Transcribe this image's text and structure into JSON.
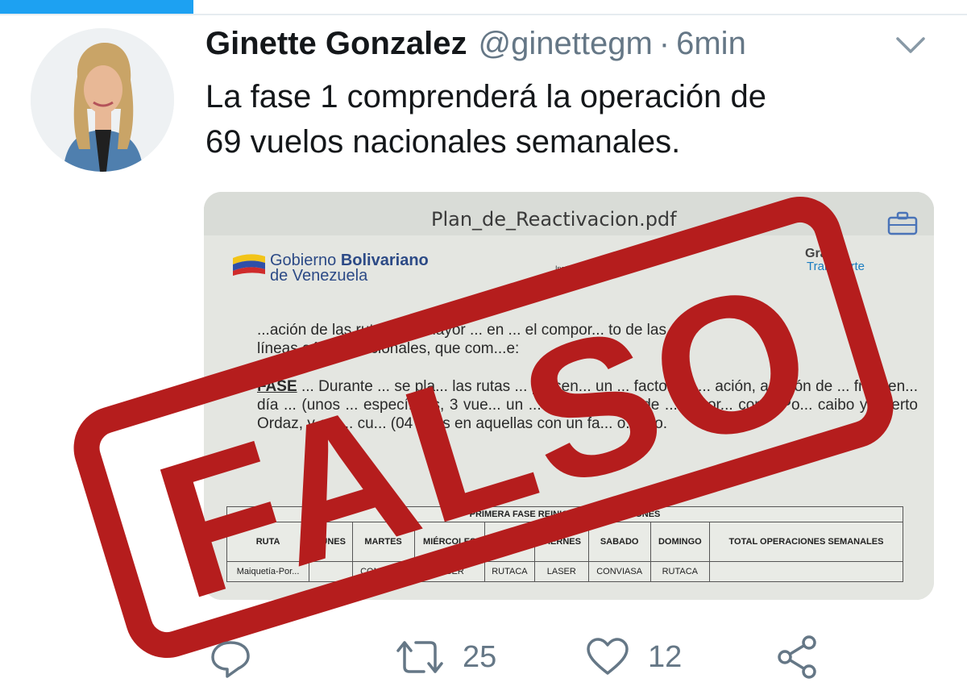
{
  "tweet": {
    "author_name": "Ginette Gonzalez",
    "handle": "@ginettegm",
    "separator": "·",
    "time": "6min",
    "text_line1": "La fase 1 comprenderá la operación de",
    "text_line2": "69 vuelos nacionales semanales."
  },
  "media": {
    "filename": "Plan_de_Reactivacion.pdf",
    "gov_line1_a": "Gobierno ",
    "gov_line1_b": "Bolivariano",
    "gov_line2": "de Venezuela",
    "inac_label": "Instituto Nacional de Aeronáutica Civil",
    "gran_label": "Gran",
    "trans_label": "Transporte",
    "para1_line1": "...ación de las rutas con mayor ... en ... el compor... to de las",
    "para1_line2": "líneas aéreas nacionales, que com...e:",
    "fase_word": "FASE",
    "para2": "... Durante ... se pla... las rutas ... presen... un ... factor de ... ación, a razón de ... frecuen... día ... (unos ... específicos, 3 vue... un ... ración) en l... de ... impor... como Po... caibo y Puerto Ordaz, y ent... cu... (04 ... es en aquellas con un fa... o... ejo.",
    "table_title": "PRIMERA FASE REINICIO DE OPERACIONES",
    "table_headers": [
      "RUTA",
      "LUNES",
      "MARTES",
      "MIÉRCOLES",
      "JUEVES",
      "VIERNES",
      "SABADO",
      "DOMINGO",
      "TOTAL OPERACIONES SEMANALES"
    ],
    "table_row": [
      "Maiquetía-Por...",
      "",
      "CONVIASA",
      "LASER",
      "RUTACA",
      "LASER",
      "CONVIASA",
      "RUTACA",
      ""
    ]
  },
  "stamp": {
    "text": "FALSO",
    "color": "#b51d1d"
  },
  "actions": {
    "reply_icon": "reply-icon",
    "retweet_icon": "retweet-icon",
    "retweet_count": "25",
    "like_icon": "heart-icon",
    "like_count": "12",
    "share_icon": "share-icon"
  },
  "colors": {
    "accent": "#1da1f2",
    "text": "#14171a",
    "muted": "#657786"
  }
}
